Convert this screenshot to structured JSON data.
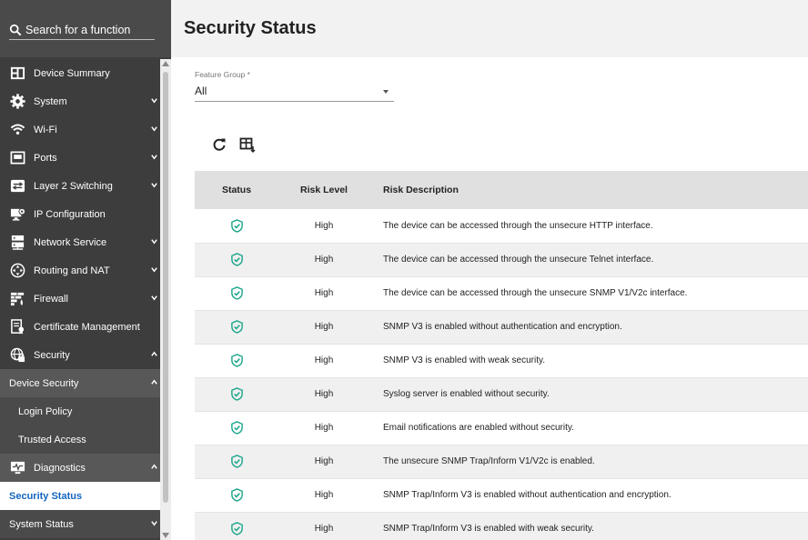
{
  "search": {
    "placeholder": "Search for a function"
  },
  "sidebar": {
    "items": [
      {
        "label": "Device Summary",
        "icon": "device-summary-icon"
      },
      {
        "label": "System",
        "icon": "gear-icon"
      },
      {
        "label": "Wi-Fi",
        "icon": "wifi-icon"
      },
      {
        "label": "Ports",
        "icon": "port-icon"
      },
      {
        "label": "Layer 2 Switching",
        "icon": "switch-icon"
      },
      {
        "label": "IP Configuration",
        "icon": "ip-config-icon"
      },
      {
        "label": "Network Service",
        "icon": "network-service-icon"
      },
      {
        "label": "Routing and NAT",
        "icon": "routing-icon"
      },
      {
        "label": "Firewall",
        "icon": "firewall-icon"
      },
      {
        "label": "Certificate Management",
        "icon": "certificate-icon"
      },
      {
        "label": "Security",
        "icon": "security-icon"
      },
      {
        "label": "Device Security"
      },
      {
        "label": "Login Policy"
      },
      {
        "label": "Trusted Access"
      },
      {
        "label": "Diagnostics",
        "icon": "diagnostics-icon"
      },
      {
        "label": "Security Status"
      },
      {
        "label": "System Status"
      }
    ]
  },
  "header": {
    "title": "Security Status"
  },
  "filter": {
    "label": "Feature Group *",
    "value": "All"
  },
  "table": {
    "columns": [
      "Status",
      "Risk Level",
      "Risk Description"
    ],
    "rows": [
      {
        "risk": "High",
        "desc": "The device can be accessed through the unsecure HTTP interface."
      },
      {
        "risk": "High",
        "desc": "The device can be accessed through the unsecure Telnet interface."
      },
      {
        "risk": "High",
        "desc": "The device can be accessed through the unsecure SNMP V1/V2c interface."
      },
      {
        "risk": "High",
        "desc": "SNMP V3 is enabled without authentication and encryption."
      },
      {
        "risk": "High",
        "desc": "SNMP V3 is enabled with weak security."
      },
      {
        "risk": "High",
        "desc": "Syslog server is enabled without security."
      },
      {
        "risk": "High",
        "desc": "Email notifications are enabled without security."
      },
      {
        "risk": "High",
        "desc": "The unsecure SNMP Trap/Inform V1/V2c is enabled."
      },
      {
        "risk": "High",
        "desc": "SNMP Trap/Inform V3 is enabled without authentication and encryption."
      },
      {
        "risk": "High",
        "desc": "SNMP Trap/Inform V3 is enabled with weak security."
      }
    ]
  },
  "colors": {
    "accent": "#1565c0",
    "status_ok": "#1aa58a",
    "sidebar_bg": "#3d3d3d"
  }
}
